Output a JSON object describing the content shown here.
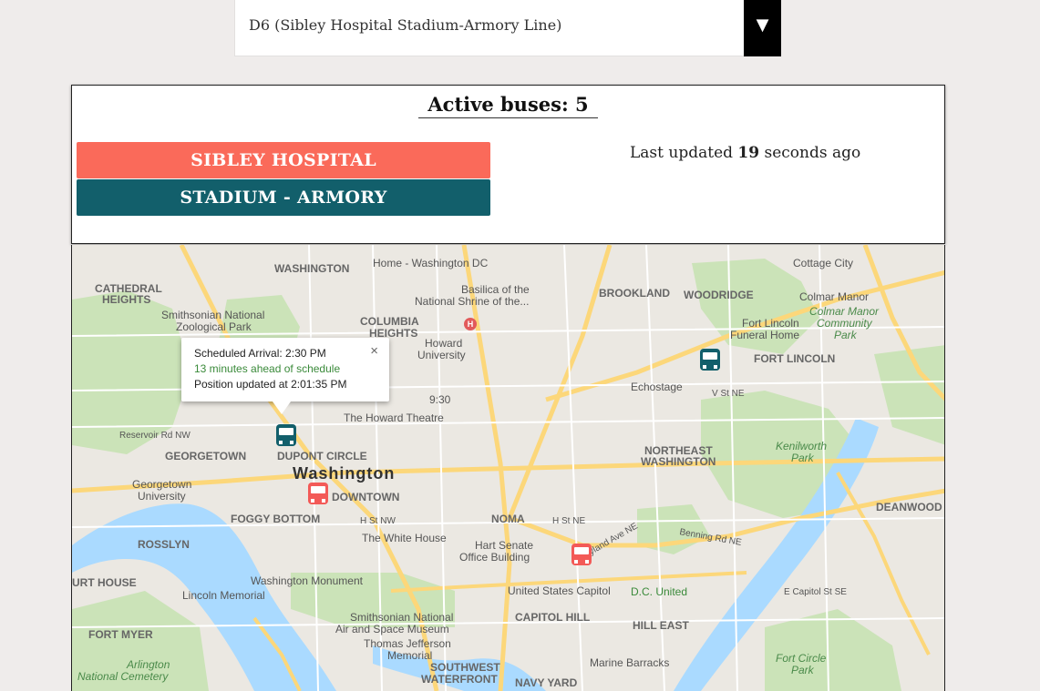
{
  "route_select": {
    "selected": "D6 (Sibley Hospital Stadium-Armory Line)",
    "arrow": "▼"
  },
  "panel": {
    "active_buses": "Active buses: 5",
    "directions": [
      {
        "label": "SIBLEY HOSPITAL",
        "color": "#fa6a5a"
      },
      {
        "label": "STADIUM - ARMORY",
        "color": "#125f6b"
      }
    ],
    "updated_prefix": "Last updated ",
    "updated_value": "19",
    "updated_suffix": " seconds ago"
  },
  "popup": {
    "arrival": "Scheduled Arrival: 2:30 PM",
    "status": "13 minutes ahead of schedule",
    "position": "Position updated at 2:01:35 PM",
    "close": "×",
    "status_color": "#3a8a3a"
  },
  "map": {
    "labels": {
      "home_washington": "Home - Washington DC",
      "woodley": "WASHINGTON",
      "cathedral": "CATHEDRAL",
      "heights": "HEIGHTS",
      "basilica1": "Basilica of the",
      "basilica2": "National Shrine of the...",
      "brookland": "BROOKLAND",
      "woodridge": "WOODRIDGE",
      "cottage": "Cottage City",
      "colmar1": "Colmar Manor",
      "colmar2": "Colmar Manor",
      "colmar3": "Community",
      "colmar4": "Park",
      "fortlincoln1": "Fort Lincoln",
      "fortlincoln2": "Funeral Home",
      "fortlincoln3": "FORT LINCOLN",
      "smithsonian_zoo1": "Smithsonian National",
      "smithsonian_zoo2": "Zoological Park",
      "columbia1": "COLUMBIA",
      "columbia2": "HEIGHTS",
      "howard1": "Howard",
      "howard2": "University",
      "time930": "9:30",
      "echostage": "Echostage",
      "howard_theatre": "The Howard Theatre",
      "reservoir": "Reservoir Rd NW",
      "georgetown": "GEORGETOWN",
      "dupont": "DUPONT CIRCLE",
      "washington": "Washington",
      "georgetown_u1": "Georgetown",
      "georgetown_u2": "University",
      "downtown": "DOWNTOWN",
      "northeast1": "NORTHEAST",
      "northeast2": "WASHINGTON",
      "kenilworth1": "Kenilworth",
      "kenilworth2": "Park",
      "deanwood": "DEANWOOD",
      "foggy": "FOGGY BOTTOM",
      "rosslyn": "ROSSLYN",
      "whitehouse": "The White House",
      "noma": "NOMA",
      "hartsenate1": "Hart Senate",
      "hartsenate2": "Office Building",
      "washmon": "Washington Monument",
      "lincoln": "Lincoln Memorial",
      "capitol": "United States Capitol",
      "dcunited": "D.C. United",
      "capitolhill": "CAPITOL HILL",
      "hilleast": "HILL EAST",
      "fortmyer": "FORT MYER",
      "airspace1": "Smithsonian National",
      "airspace2": "Air and Space Museum",
      "jefferson1": "Thomas Jefferson",
      "jefferson2": "Memorial",
      "arlington1": "Arlington",
      "arlington2": "National Cemetery",
      "southwest1": "SOUTHWEST",
      "southwest2": "WATERFRONT",
      "marine": "Marine Barracks",
      "navyyard": "NAVY YARD",
      "fortcircle1": "Fort Circle",
      "fortcircle2": "Park",
      "courthouse": "URT HOUSE",
      "ecapitol": "E Capitol St SE",
      "hstnw": "H St NW",
      "hstne": "H St NE",
      "vstne": "V St NE",
      "maryland": "Maryland Ave NE",
      "benning": "Benning Rd NE"
    }
  },
  "colors": {
    "accent_red": "#fa6a5a",
    "accent_teal": "#125f6b"
  }
}
